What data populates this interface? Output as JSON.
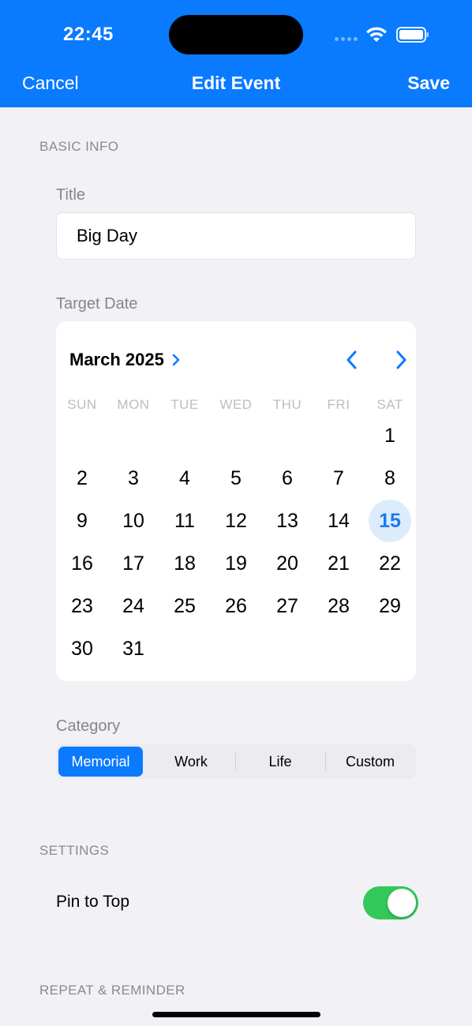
{
  "status_bar": {
    "time": "22:45"
  },
  "nav": {
    "cancel": "Cancel",
    "title": "Edit Event",
    "save": "Save"
  },
  "sections": {
    "basic_info": "BASIC INFO",
    "settings": "SETTINGS",
    "repeat_reminder": "REPEAT & REMINDER"
  },
  "fields": {
    "title_label": "Title",
    "title_value": "Big Day",
    "target_date_label": "Target Date",
    "category_label": "Category"
  },
  "calendar": {
    "month_label": "March 2025",
    "weekdays": [
      "SUN",
      "MON",
      "TUE",
      "WED",
      "THU",
      "FRI",
      "SAT"
    ],
    "first_weekday_index": 6,
    "days_in_month": 31,
    "selected_day": 15,
    "selected_color": "#1A7BEF",
    "selected_bg": "#DDECFB"
  },
  "category": {
    "options": [
      "Memorial",
      "Work",
      "Life",
      "Custom"
    ],
    "selected": "Memorial"
  },
  "settings": {
    "pin_to_top_label": "Pin to Top",
    "pin_to_top_on": true
  },
  "colors": {
    "accent": "#0A7AFF",
    "toggle_on": "#34C759",
    "background": "#F1F1F6"
  }
}
